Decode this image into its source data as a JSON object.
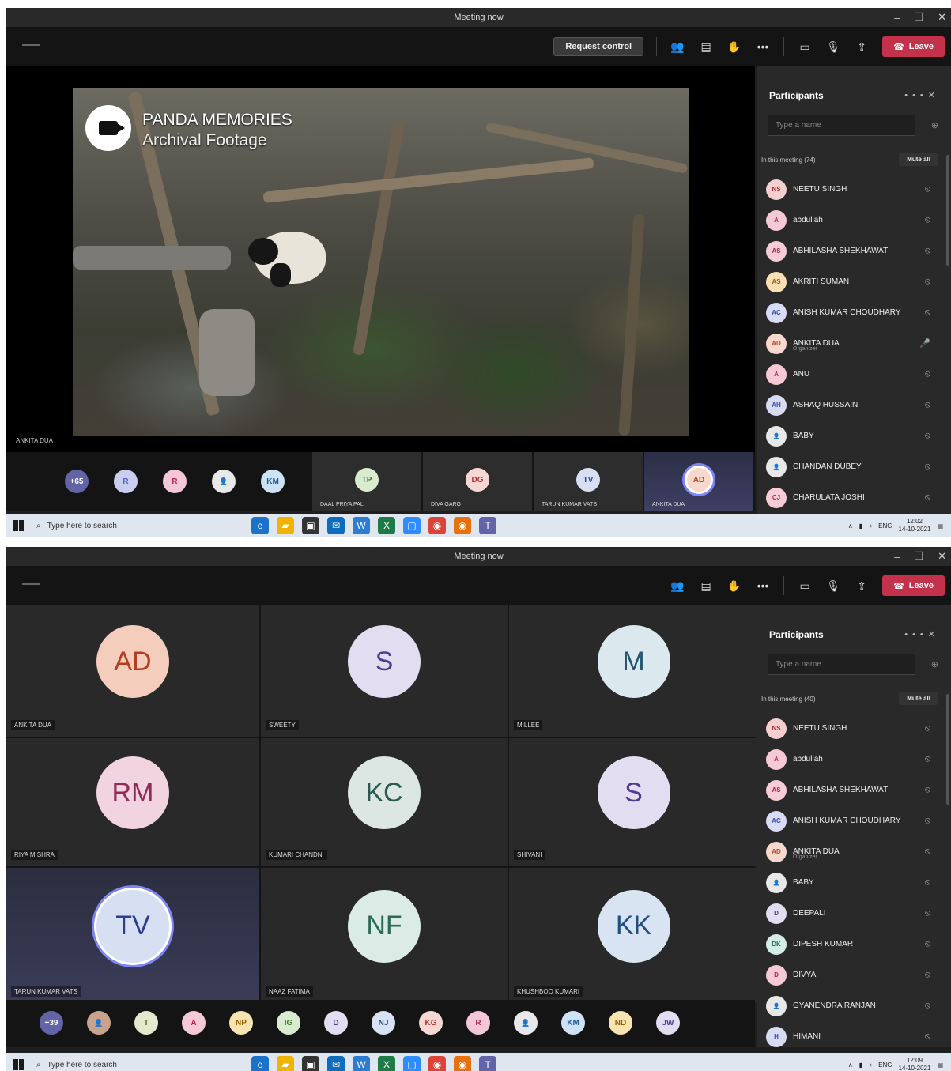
{
  "colors": {
    "accent": "#6264a7",
    "leave": "#c4314b",
    "panel": "#292929",
    "bg": "#1f1f1f"
  },
  "shot1": {
    "window_title": "Meeting now",
    "request_control": "Request control",
    "leave_label": "Leave",
    "video": {
      "title_line1": "PANDA MEMORIES",
      "title_line2": "Archival Footage"
    },
    "stage_label": "ANKITA DUA",
    "strip": {
      "overflow": "+65",
      "avatars": [
        {
          "initials": "R",
          "bg": "#c9cdf0",
          "fg": "#5b5fc7"
        },
        {
          "initials": "R",
          "bg": "#f3c7d8",
          "fg": "#b4265b"
        },
        {
          "initials": "",
          "bg": "#e8e8e8",
          "fg": "#333",
          "photo": true
        },
        {
          "initials": "KM",
          "bg": "#cde3f5",
          "fg": "#1c5d99"
        }
      ],
      "tiles": [
        {
          "initials": "TP",
          "name": "DAAL PRIYA PAL",
          "bg": "#d9eccf",
          "fg": "#3f7a2a"
        },
        {
          "initials": "DG",
          "name": "DIVA GARG",
          "bg": "#f7d7d4",
          "fg": "#b0322a"
        },
        {
          "initials": "TV",
          "name": "TARUN KUMAR VATS",
          "bg": "#d7dff2",
          "fg": "#30449c"
        },
        {
          "initials": "AD",
          "name": "ANKITA DUA",
          "bg": "#f6d8cc",
          "fg": "#b9452a"
        }
      ]
    },
    "panel": {
      "title": "Participants",
      "search_placeholder": "Type a name",
      "section": "In this meeting (74)",
      "mute_all": "Mute all",
      "people": [
        {
          "initials": "NS",
          "name": "NEETU SINGH",
          "bg": "#f3cfcf",
          "fg": "#b12c2c"
        },
        {
          "initials": "A",
          "name": "abdullah",
          "bg": "#f6c9d6",
          "fg": "#b0264f"
        },
        {
          "initials": "AS",
          "name": "ABHILASHA SHEKHAWAT",
          "bg": "#f6cdd6",
          "fg": "#b0264f"
        },
        {
          "initials": "AS",
          "name": "AKRITI SUMAN",
          "bg": "#f8e0b3",
          "fg": "#9a5b00"
        },
        {
          "initials": "AC",
          "name": "ANISH KUMAR CHOUDHARY",
          "bg": "#d8ddf5",
          "fg": "#3b4ba8"
        },
        {
          "initials": "AD",
          "name": "ANKITA DUA",
          "sub": "Organizer",
          "bg": "#f6d8cc",
          "fg": "#b9452a",
          "unmuted": true
        },
        {
          "initials": "A",
          "name": "ANU",
          "bg": "#f6c9d6",
          "fg": "#b0264f"
        },
        {
          "initials": "AH",
          "name": "ASHAQ HUSSAIN",
          "bg": "#d7dcf3",
          "fg": "#3b4ba8"
        },
        {
          "initials": "",
          "name": "BABY",
          "bg": "#e8e8e8",
          "fg": "#333",
          "photo": true
        },
        {
          "initials": "",
          "name": "CHANDAN DUBEY",
          "bg": "#e8e8e8",
          "fg": "#333",
          "photo": true
        },
        {
          "initials": "CJ",
          "name": "CHARULATA JOSHI",
          "bg": "#f6cdd6",
          "fg": "#b0264f"
        }
      ]
    },
    "taskbar": {
      "search": "Type here to search",
      "time": "12:02",
      "date": "14-10-2021",
      "lang": "ENG"
    }
  },
  "shot2": {
    "window_title": "Meeting now",
    "leave_label": "Leave",
    "grid": [
      {
        "initials": "AD",
        "name": "ANKITA DUA",
        "bg": "#f5cdbd",
        "fg": "#b43d1f"
      },
      {
        "initials": "S",
        "name": "SWEETY",
        "bg": "#e2ddf1",
        "fg": "#4d3b8c"
      },
      {
        "initials": "M",
        "name": "MILLEE",
        "bg": "#dbe9ee",
        "fg": "#23566c"
      },
      {
        "initials": "RM",
        "name": "RIYA MISHRA",
        "bg": "#f2d3e0",
        "fg": "#922a56"
      },
      {
        "initials": "KC",
        "name": "KUMARI CHANDNI",
        "bg": "#dce6e3",
        "fg": "#2b5a50"
      },
      {
        "initials": "S",
        "name": "SHIVANI",
        "bg": "#e2ddf1",
        "fg": "#4d3b8c"
      },
      {
        "initials": "TV",
        "name": "TARUN KUMAR VATS",
        "bg": "#d7dff2",
        "fg": "#2c3f8f",
        "active": true
      },
      {
        "initials": "NF",
        "name": "NAAZ FATIMA",
        "bg": "#dbece6",
        "fg": "#2b6a55"
      },
      {
        "initials": "KK",
        "name": "KHUSHBOO KUMARI",
        "bg": "#d8e4f2",
        "fg": "#234f82"
      }
    ],
    "strip": [
      {
        "initials": "+39",
        "bg": "#6264a7",
        "fg": "#ffffff"
      },
      {
        "initials": "",
        "bg": "#c9a28c",
        "fg": "#333",
        "photo": true
      },
      {
        "initials": "T",
        "bg": "#e4e8cf",
        "fg": "#5f6a1f"
      },
      {
        "initials": "A",
        "bg": "#f6c9d6",
        "fg": "#b0264f"
      },
      {
        "initials": "NP",
        "bg": "#f8e4b0",
        "fg": "#946000"
      },
      {
        "initials": "IG",
        "bg": "#d9eccf",
        "fg": "#3f7a2a"
      },
      {
        "initials": "D",
        "bg": "#e2ddf1",
        "fg": "#4d3b8c"
      },
      {
        "initials": "NJ",
        "bg": "#d7e3f5",
        "fg": "#234f82"
      },
      {
        "initials": "KG",
        "bg": "#f7d7d4",
        "fg": "#b0322a"
      },
      {
        "initials": "R",
        "bg": "#f3c7d8",
        "fg": "#b4265b"
      },
      {
        "initials": "",
        "bg": "#e8e8e8",
        "fg": "#333",
        "photo": true
      },
      {
        "initials": "KM",
        "bg": "#cde3f5",
        "fg": "#1c5d99"
      },
      {
        "initials": "ND",
        "bg": "#f8e4b0",
        "fg": "#946000"
      },
      {
        "initials": "JW",
        "bg": "#e2ddf1",
        "fg": "#4d3b8c"
      }
    ],
    "panel": {
      "title": "Participants",
      "search_placeholder": "Type a name",
      "section": "In this meeting (40)",
      "mute_all": "Mute all",
      "people": [
        {
          "initials": "NS",
          "name": "NEETU SINGH",
          "bg": "#f3cfcf",
          "fg": "#b12c2c"
        },
        {
          "initials": "A",
          "name": "abdullah",
          "bg": "#f6c9d6",
          "fg": "#b0264f"
        },
        {
          "initials": "AS",
          "name": "ABHILASHA SHEKHAWAT",
          "bg": "#f6cdd6",
          "fg": "#b0264f"
        },
        {
          "initials": "AC",
          "name": "ANISH KUMAR CHOUDHARY",
          "bg": "#d8ddf5",
          "fg": "#3b4ba8"
        },
        {
          "initials": "AD",
          "name": "ANKITA DUA",
          "sub": "Organizer",
          "bg": "#f6d8cc",
          "fg": "#b9452a"
        },
        {
          "initials": "",
          "name": "BABY",
          "bg": "#e8e8e8",
          "fg": "#333",
          "photo": true
        },
        {
          "initials": "D",
          "name": "DEEPALI",
          "bg": "#e2ddf1",
          "fg": "#4d3b8c"
        },
        {
          "initials": "DK",
          "name": "DIPESH KUMAR",
          "bg": "#d4ede6",
          "fg": "#21705a"
        },
        {
          "initials": "D",
          "name": "DIVYA",
          "bg": "#f6c9d6",
          "fg": "#b0264f"
        },
        {
          "initials": "",
          "name": "GYANENDRA RANJAN",
          "bg": "#e8e8e8",
          "fg": "#333",
          "photo": true
        },
        {
          "initials": "H",
          "name": "HIMANI",
          "bg": "#d7dcf3",
          "fg": "#3b4ba8"
        }
      ]
    },
    "taskbar": {
      "search": "Type here to search",
      "time": "12:09",
      "date": "14-10-2021",
      "lang": "ENG"
    }
  }
}
